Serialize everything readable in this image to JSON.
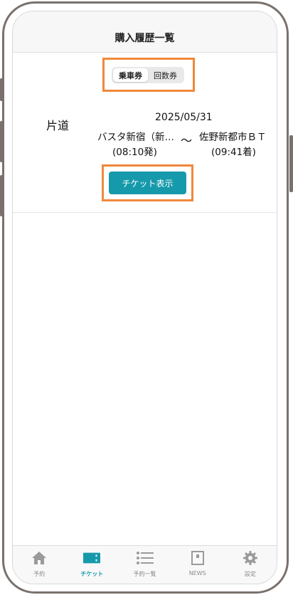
{
  "header": {
    "title": "購入履歴一覧"
  },
  "segment": {
    "items": [
      "乗車券",
      "回数券"
    ],
    "active": 0
  },
  "trip": {
    "type": "片道",
    "date": "2025/05/31",
    "from_name": "バスタ新宿（新…",
    "from_time": "(08:10発)",
    "separator": "～",
    "to_name": "佐野新都市ＢＴ",
    "to_time": "(09:41着)"
  },
  "ticket_button": {
    "label": "チケット表示"
  },
  "tabbar": {
    "items": [
      {
        "label": "予約",
        "icon": "home-icon"
      },
      {
        "label": "チケット",
        "icon": "ticket-icon"
      },
      {
        "label": "予約一覧",
        "icon": "list-icon"
      },
      {
        "label": "NEWS",
        "icon": "news-icon"
      },
      {
        "label": "設定",
        "icon": "gear-icon"
      }
    ],
    "active": 1
  },
  "colors": {
    "accent": "#169aab",
    "highlight": "#f0883a",
    "frame": "#7a716c"
  }
}
